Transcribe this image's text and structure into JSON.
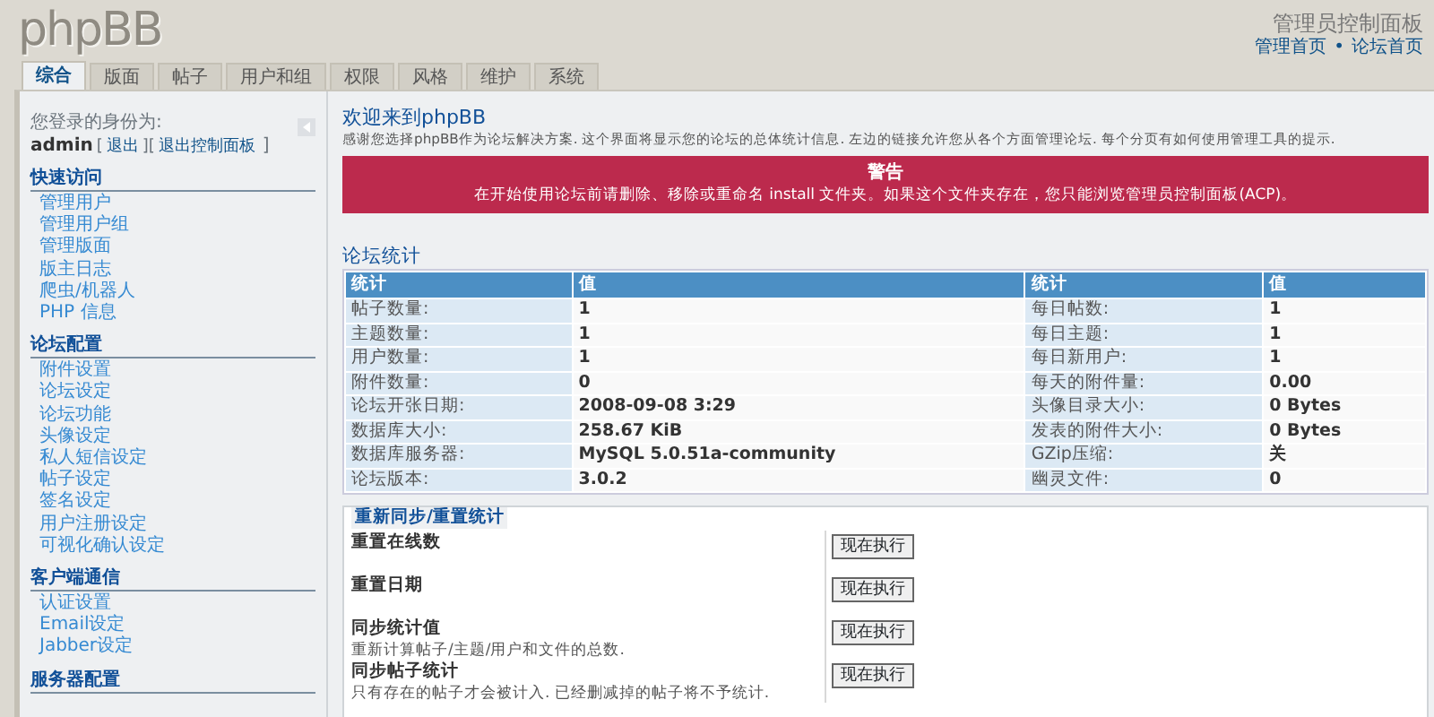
{
  "header": {
    "logo": "phpBB",
    "title": "管理员控制面板",
    "links": [
      "管理首页",
      "论坛首页"
    ],
    "separator": "•"
  },
  "tabs": [
    {
      "label": "综合",
      "selected": true
    },
    {
      "label": "版面",
      "selected": false
    },
    {
      "label": "帖子",
      "selected": false
    },
    {
      "label": "用户和组",
      "selected": false
    },
    {
      "label": "权限",
      "selected": false
    },
    {
      "label": "风格",
      "selected": false
    },
    {
      "label": "维护",
      "selected": false
    },
    {
      "label": "系统",
      "selected": false
    }
  ],
  "sidebar": {
    "login_label": "您登录的身份为:",
    "username": "admin",
    "brackets": [
      "[",
      "][",
      "]"
    ],
    "user_links": [
      "退出",
      "退出控制面板"
    ],
    "sections": [
      {
        "title": "快速访问",
        "items": [
          "管理用户",
          "管理用户组",
          "管理版面",
          "版主日志",
          "爬虫/机器人",
          "PHP 信息"
        ]
      },
      {
        "title": "论坛配置",
        "items": [
          "附件设置",
          "论坛设定",
          "论坛功能",
          "头像设定",
          "私人短信设定",
          "帖子设定",
          "签名设定",
          "用户注册设定",
          "可视化确认设定"
        ]
      },
      {
        "title": "客户端通信",
        "items": [
          "认证设置",
          "Email设定",
          "Jabber设定"
        ]
      },
      {
        "title": "服务器配置"
      }
    ]
  },
  "welcome": {
    "title": "欢迎来到phpBB",
    "text": "感谢您选择phpBB作为论坛解决方案. 这个界面将显示您的论坛的总体统计信息. 左边的链接允许您从各个方面管理论坛. 每个分页有如何使用管理工具的提示."
  },
  "warning": {
    "title": "警告",
    "text": "在开始使用论坛前请删除、移除或重命名 install 文件夹。如果这个文件夹存在，您只能浏览管理员控制面板(ACP)。"
  },
  "stats": {
    "title": "论坛统计",
    "columns": [
      "统计",
      "值",
      "统计",
      "值"
    ],
    "rows": [
      [
        "帖子数量:",
        "1",
        "每日帖数:",
        "1"
      ],
      [
        "主题数量:",
        "1",
        "每日主题:",
        "1"
      ],
      [
        "用户数量:",
        "1",
        "每日新用户:",
        "1"
      ],
      [
        "附件数量:",
        "0",
        "每天的附件量:",
        "0.00"
      ],
      [
        "论坛开张日期:",
        "2008-09-08 3:29",
        "头像目录大小:",
        "0 Bytes"
      ],
      [
        "数据库大小:",
        "258.67 KiB",
        "发表的附件大小:",
        "0 Bytes"
      ],
      [
        "数据库服务器:",
        "MySQL 5.0.51a-community",
        "GZip压缩:",
        "关"
      ],
      [
        "论坛版本:",
        "3.0.2",
        "幽灵文件:",
        "0"
      ]
    ]
  },
  "resync": {
    "title": "重新同步/重置统计",
    "rows": [
      {
        "label": "重置在线数",
        "button": "现在执行"
      },
      {
        "label": "重置日期",
        "button": "现在执行"
      },
      {
        "label": "同步统计值",
        "description": "重新计算帖子/主题/用户和文件的总数.",
        "button": "现在执行"
      },
      {
        "label": "同步帖子统计",
        "description": "只有存在的帖子才会被计入. 已经删减掉的帖子将不予统计.",
        "button": "现在执行"
      }
    ]
  }
}
